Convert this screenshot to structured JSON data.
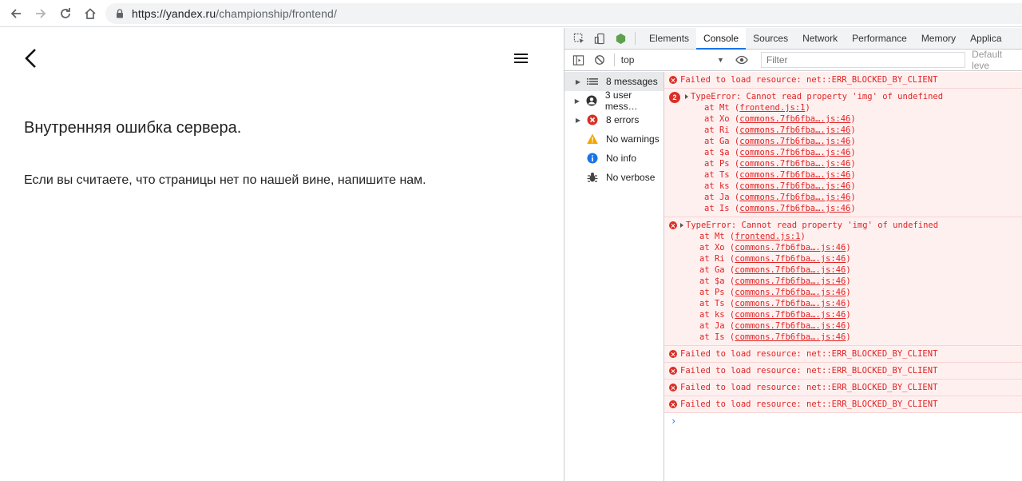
{
  "browser": {
    "url_host": "https://yandex.ru",
    "url_path": "/championship/frontend/"
  },
  "page": {
    "error_title": "Внутренняя ошибка сервера.",
    "error_text": "Если вы считаете, что страницы нет по нашей вине, напишите нам."
  },
  "devtools": {
    "tabs": [
      "Elements",
      "Console",
      "Sources",
      "Network",
      "Performance",
      "Memory",
      "Applica"
    ],
    "active_tab": "Console",
    "context": "top",
    "filter_placeholder": "Filter",
    "levels": "Default leve",
    "sidebar": [
      {
        "label": "8 messages",
        "icon": "list-icon",
        "arrow": true,
        "selected": true
      },
      {
        "label": "3 user mess…",
        "icon": "user-icon",
        "arrow": true
      },
      {
        "label": "8 errors",
        "icon": "error-icon",
        "arrow": true
      },
      {
        "label": "No warnings",
        "icon": "warning-icon",
        "arrow": false
      },
      {
        "label": "No info",
        "icon": "info-icon",
        "arrow": false
      },
      {
        "label": "No verbose",
        "icon": "bug-icon",
        "arrow": false
      }
    ],
    "messages": {
      "blocked": "Failed to load resource: net::ERR_BLOCKED_BY_CLIENT",
      "type_error": "TypeError: Cannot read property 'img' of undefined",
      "group1_count": "2",
      "stack": [
        {
          "fn": "at Mt",
          "src": "frontend.js:1"
        },
        {
          "fn": "at Xo",
          "src": "commons.7fb6fba….js:46"
        },
        {
          "fn": "at Ri",
          "src": "commons.7fb6fba….js:46"
        },
        {
          "fn": "at Ga",
          "src": "commons.7fb6fba….js:46"
        },
        {
          "fn": "at $a",
          "src": "commons.7fb6fba….js:46"
        },
        {
          "fn": "at Ps",
          "src": "commons.7fb6fba….js:46"
        },
        {
          "fn": "at Ts",
          "src": "commons.7fb6fba….js:46"
        },
        {
          "fn": "at ks",
          "src": "commons.7fb6fba….js:46"
        },
        {
          "fn": "at Ja",
          "src": "commons.7fb6fba….js:46"
        },
        {
          "fn": "at Is",
          "src": "commons.7fb6fba….js:46"
        }
      ],
      "prompt": "›"
    },
    "colors": {
      "error": "#e02424",
      "accent": "#1a73e8"
    }
  }
}
